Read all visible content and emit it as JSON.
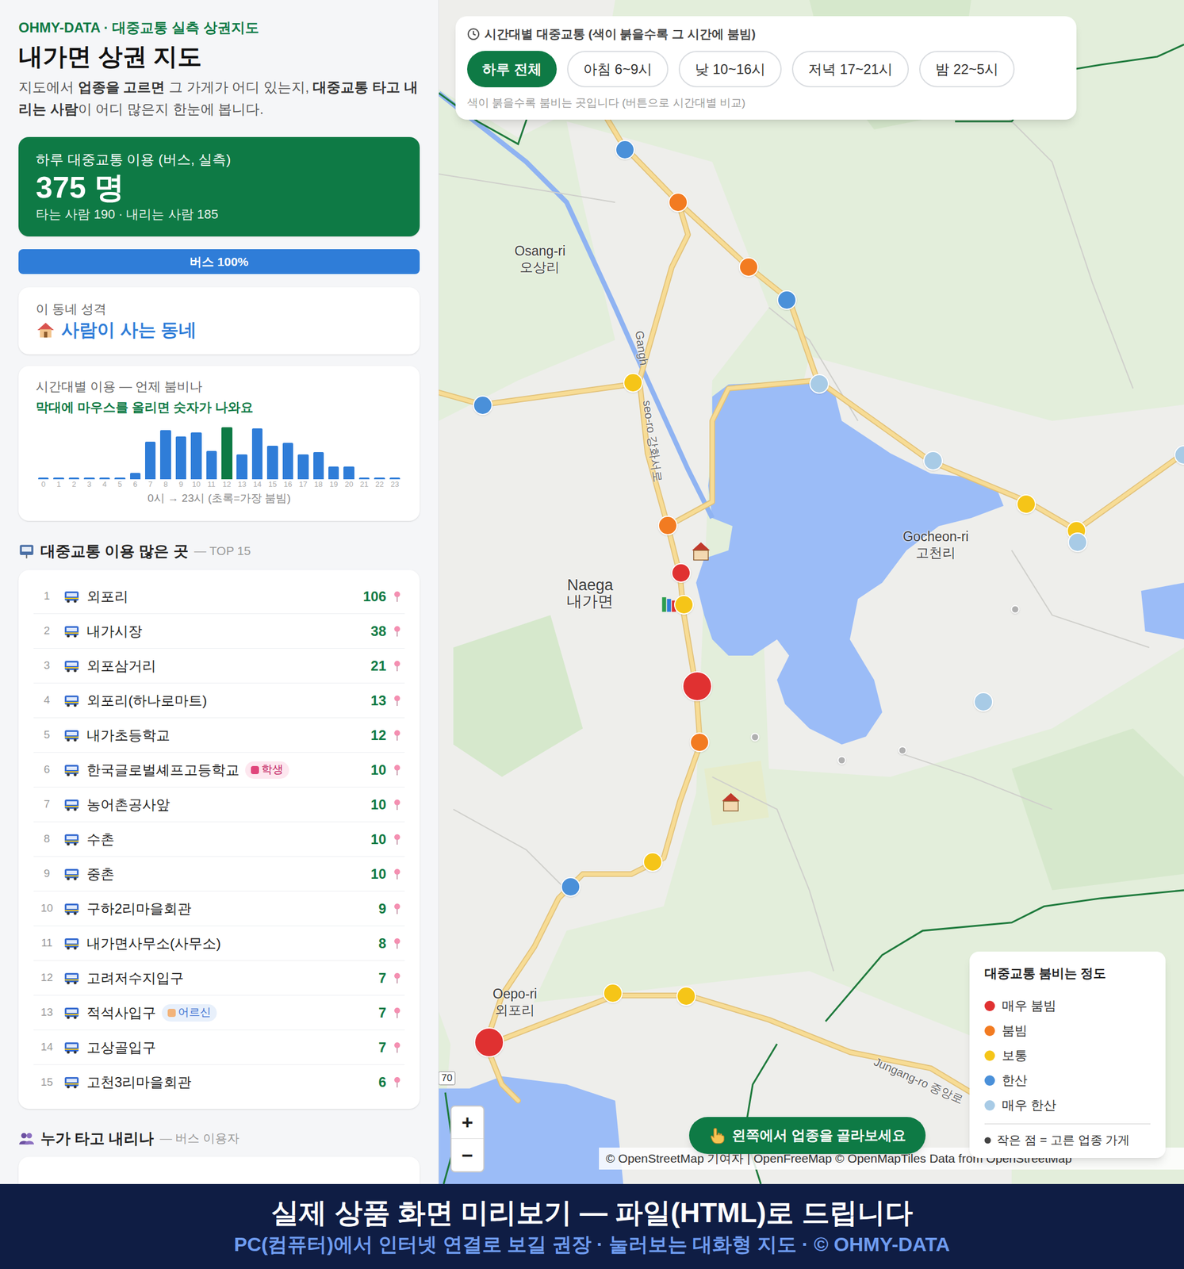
{
  "brand": "OHMY-DATA · 대중교통 실측 상권지도",
  "title": "내가면 상권 지도",
  "intro": [
    {
      "text": "지도에서 ",
      "bold": false
    },
    {
      "text": "업종을 고르면",
      "bold": true
    },
    {
      "text": " 그 가게가 어디 있는지, ",
      "bold": false
    },
    {
      "text": "대중교통 타고 내리는 사람",
      "bold": true
    },
    {
      "text": "이 어디 많은지 한눈에 봅니다.",
      "bold": false
    }
  ],
  "summary": {
    "label": "하루 대중교통 이용 (버스, 실측)",
    "total": "375 명",
    "detail": "타는 사람 190 · 내리는 사람 185"
  },
  "mode_bar": {
    "label": "버스 100%",
    "level": 1
  },
  "character": {
    "label": "이 동네 성격",
    "value": "사람이 사는 동네"
  },
  "hourly": {
    "title": "시간대별 이용 — 언제 붐비나",
    "hint": "막대에 마우스를 올리면 숫자가 나와요",
    "hours": [
      "0",
      "1",
      "2",
      "3",
      "4",
      "5",
      "6",
      "7",
      "8",
      "9",
      "10",
      "11",
      "12",
      "13",
      "14",
      "15",
      "16",
      "17",
      "18",
      "19",
      "20",
      "21",
      "22",
      "23"
    ],
    "values": [
      0,
      0,
      0,
      0,
      0,
      0,
      5,
      29,
      38,
      33,
      36,
      22,
      40,
      19,
      39,
      26,
      28,
      19,
      21,
      10,
      10,
      0,
      0,
      0
    ],
    "peak": [
      false,
      false,
      false,
      false,
      false,
      false,
      false,
      false,
      false,
      false,
      false,
      false,
      true,
      false,
      false,
      false,
      false,
      false,
      false,
      false,
      false,
      false,
      false,
      false
    ],
    "caption": "0시 → 23시 (초록=가장 붐빔)"
  },
  "top": {
    "title": "대중교통 이용 많은 곳",
    "subtitle": "— TOP 15",
    "rows": [
      {
        "rank": "1",
        "name": "외포리",
        "count": "106"
      },
      {
        "rank": "2",
        "name": "내가시장",
        "count": "38"
      },
      {
        "rank": "3",
        "name": "외포삼거리",
        "count": "21"
      },
      {
        "rank": "4",
        "name": "외포리(하나로마트)",
        "count": "13"
      },
      {
        "rank": "5",
        "name": "내가초등학교",
        "count": "12"
      },
      {
        "rank": "6",
        "name": "한국글로벌셰프고등학교",
        "count": "10",
        "badge": {
          "text": "학생",
          "kind": "student"
        }
      },
      {
        "rank": "7",
        "name": "농어촌공사앞",
        "count": "10"
      },
      {
        "rank": "8",
        "name": "수촌",
        "count": "10"
      },
      {
        "rank": "9",
        "name": "중촌",
        "count": "10"
      },
      {
        "rank": "10",
        "name": "구하2리마을회관",
        "count": "9"
      },
      {
        "rank": "11",
        "name": "내가면사무소(사무소)",
        "count": "8"
      },
      {
        "rank": "12",
        "name": "고려저수지입구",
        "count": "7"
      },
      {
        "rank": "13",
        "name": "적석사입구",
        "count": "7",
        "badge": {
          "text": "어르신",
          "kind": "senior"
        }
      },
      {
        "rank": "14",
        "name": "고상골입구",
        "count": "7"
      },
      {
        "rank": "15",
        "name": "고천3리마을회관",
        "count": "6"
      }
    ]
  },
  "riders": {
    "title": "누가 타고 내리나",
    "subtitle": "— 버스 이용자"
  },
  "time_panel": {
    "title": "시간대별 대중교통 (색이 붉을수록 그 시간에 붐빔)",
    "buttons": [
      {
        "label": "하루 전체",
        "selected": true
      },
      {
        "label": "아침 6~9시",
        "selected": false
      },
      {
        "label": "낮 10~16시",
        "selected": false
      },
      {
        "label": "저녁 17~21시",
        "selected": false
      },
      {
        "label": "밤 22~5시",
        "selected": false
      }
    ],
    "hint": "색이 붉을수록 붐비는 곳입니다 (버튼으로 시간대별 비교)"
  },
  "map": {
    "places": [
      {
        "en": "Osang-ri",
        "ko": "오상리"
      },
      {
        "en": "Naega",
        "ko": "내가면"
      },
      {
        "en": "Gocheon-ri",
        "ko": "고천리"
      },
      {
        "en": "Oepo-ri",
        "ko": "외포리"
      }
    ],
    "roads": [
      "Gangh",
      "seo-ro 강화서로",
      "Jungang-ro 중앙로"
    ],
    "shield": "70",
    "stops": [
      {
        "kind": "bus",
        "color": "#4a90d9",
        "big": false
      },
      {
        "kind": "bus",
        "color": "#f27b21",
        "big": false
      },
      {
        "kind": "bus",
        "color": "#f27b21",
        "big": false
      },
      {
        "kind": "bus",
        "color": "#4a90d9",
        "big": false
      },
      {
        "kind": "bus",
        "color": "#a8cbe6",
        "big": false
      },
      {
        "kind": "bus",
        "color": "#f5c518",
        "big": false
      },
      {
        "kind": "bus",
        "color": "#4a90d9",
        "big": false
      },
      {
        "kind": "bus",
        "color": "#a8cbe6",
        "big": false
      },
      {
        "kind": "bus",
        "color": "#f5c518",
        "big": false
      },
      {
        "kind": "bus",
        "color": "#f5c518",
        "big": false
      },
      {
        "kind": "bus",
        "color": "#a8cbe6",
        "big": false
      },
      {
        "kind": "bus",
        "color": "#a8cbe6",
        "big": false
      },
      {
        "kind": "bus",
        "color": "#f27b21",
        "big": false
      },
      {
        "kind": "bus",
        "color": "#e03131",
        "big": false
      },
      {
        "kind": "bus",
        "color": "#f5c518",
        "big": false
      },
      {
        "kind": "bus",
        "color": "#e03131",
        "big": true
      },
      {
        "kind": "bus",
        "color": "#f27b21",
        "big": false
      },
      {
        "kind": "bus",
        "color": "#a8cbe6",
        "big": false
      },
      {
        "kind": "bus",
        "color": "#f5c518",
        "big": false
      },
      {
        "kind": "bus",
        "color": "#4a90d9",
        "big": false
      },
      {
        "kind": "bus",
        "color": "#f5c518",
        "big": false
      },
      {
        "kind": "bus",
        "color": "#f5c518",
        "big": false
      },
      {
        "kind": "bus",
        "color": "#e03131",
        "big": true
      },
      {
        "kind": "shop",
        "color": "#b0b0b0",
        "big": false
      },
      {
        "kind": "shop",
        "color": "#b0b0b0",
        "big": false
      },
      {
        "kind": "shop",
        "color": "#b0b0b0",
        "big": false
      },
      {
        "kind": "shop",
        "color": "#b0b0b0",
        "big": false
      }
    ]
  },
  "zoom": {
    "in": "+",
    "out": "−"
  },
  "cta": "왼쪽에서 업종을 골라보세요",
  "attribution": "© OpenStreetMap 기여자 | OpenFreeMap © OpenMapTiles Data from OpenStreetMap",
  "legend": {
    "title": "대중교통 붐비는 정도",
    "items": [
      {
        "label": "매우 붐빔",
        "color": "#e03131"
      },
      {
        "label": "붐빔",
        "color": "#f27b21"
      },
      {
        "label": "보통",
        "color": "#f5c518"
      },
      {
        "label": "한산",
        "color": "#4a90d9"
      },
      {
        "label": "매우 한산",
        "color": "#a8cbe6"
      }
    ],
    "note": "작은 점 = 고른 업종 가게"
  },
  "banner": {
    "line1": "실제 상품 화면 미리보기 — 파일(HTML)로 드립니다",
    "line2": "PC(컴퓨터)에서 인터넷 연결로 보길 권장 · 눌러보는 대화형 지도 · © OHMY-DATA"
  }
}
